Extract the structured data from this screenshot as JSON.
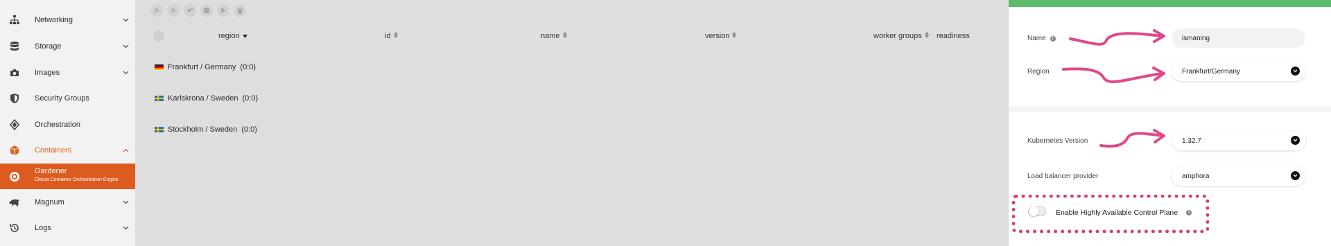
{
  "sidebar": {
    "items": [
      {
        "label": "Networking",
        "icon": "network-icon"
      },
      {
        "label": "Storage",
        "icon": "database-icon"
      },
      {
        "label": "Images",
        "icon": "camera-icon"
      },
      {
        "label": "Security Groups",
        "icon": "shield-icon"
      },
      {
        "label": "Orchestration",
        "icon": "orchestration-icon"
      },
      {
        "label": "Containers",
        "icon": "box-icon"
      },
      {
        "label": "Gardener",
        "sublabel": "Cleura Container Orchestration Engine",
        "icon": "gardener-icon"
      },
      {
        "label": "Magnum",
        "icon": "dolphin-icon"
      },
      {
        "label": "Logs",
        "icon": "history-icon"
      }
    ],
    "accent": "#de5b1f"
  },
  "table": {
    "toolbar_icons": [
      "wrench-icon",
      "wrench-icon",
      "gears-icon",
      "stop-icon",
      "play-icon",
      "trash-icon"
    ],
    "columns": [
      "region",
      "id",
      "name",
      "version",
      "worker groups",
      "readiness"
    ],
    "rows": [
      {
        "region": "Frankfurt / Germany",
        "count": "(0:0)",
        "flag": "de"
      },
      {
        "region": "Karlskrona / Sweden",
        "count": "(0:0)",
        "flag": "se"
      },
      {
        "region": "Stockholm / Sweden",
        "count": "(0:0)",
        "flag": "se"
      }
    ]
  },
  "panel": {
    "accent": "#5dbc6c",
    "name_label": "Name",
    "name_value": "ismaning",
    "region_label": "Region",
    "region_value": "Frankfurt/Germany",
    "k8s_label": "Kubernetes Version",
    "k8s_value": "1.32.7",
    "lb_label": "Load balancer provider",
    "lb_value": "amphora",
    "ha_label": "Enable Highly Available Control Plane",
    "ha_enabled": false,
    "annotation_color": "#d43d7a"
  }
}
